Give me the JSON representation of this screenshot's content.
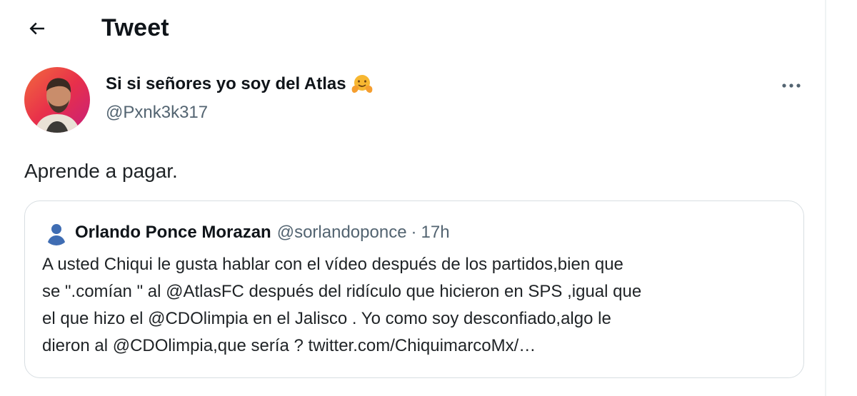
{
  "header": {
    "back_icon": "arrow-left-icon",
    "title": "Tweet"
  },
  "tweet": {
    "display_name": "Si si señores yo soy del Atlas",
    "emoji_icon": "hugging-face-emoji-icon",
    "handle": "@Pxnk3k317",
    "more_icon": "ellipsis-icon",
    "text": "Aprende a pagar."
  },
  "quoted_tweet": {
    "name": "Orlando Ponce Morazan",
    "handle": "@sorlandoponce",
    "separator": "·",
    "time": "17h",
    "lines": [
      "A usted Chiqui le gusta hablar con el vídeo después de los partidos,bien que",
      "se \".comían \" al @AtlasFC  después del ridículo que hicieron en SPS ,igual que",
      "el que hizo el @CDOlimpia  en el Jalisco . Yo como soy desconfiado,algo le",
      "dieron al @CDOlimpia,que sería ? twitter.com/ChiquimarcoMx/…"
    ]
  },
  "colors": {
    "text_primary": "#0f1419",
    "text_secondary": "#536471",
    "border": "#d8dee2"
  }
}
